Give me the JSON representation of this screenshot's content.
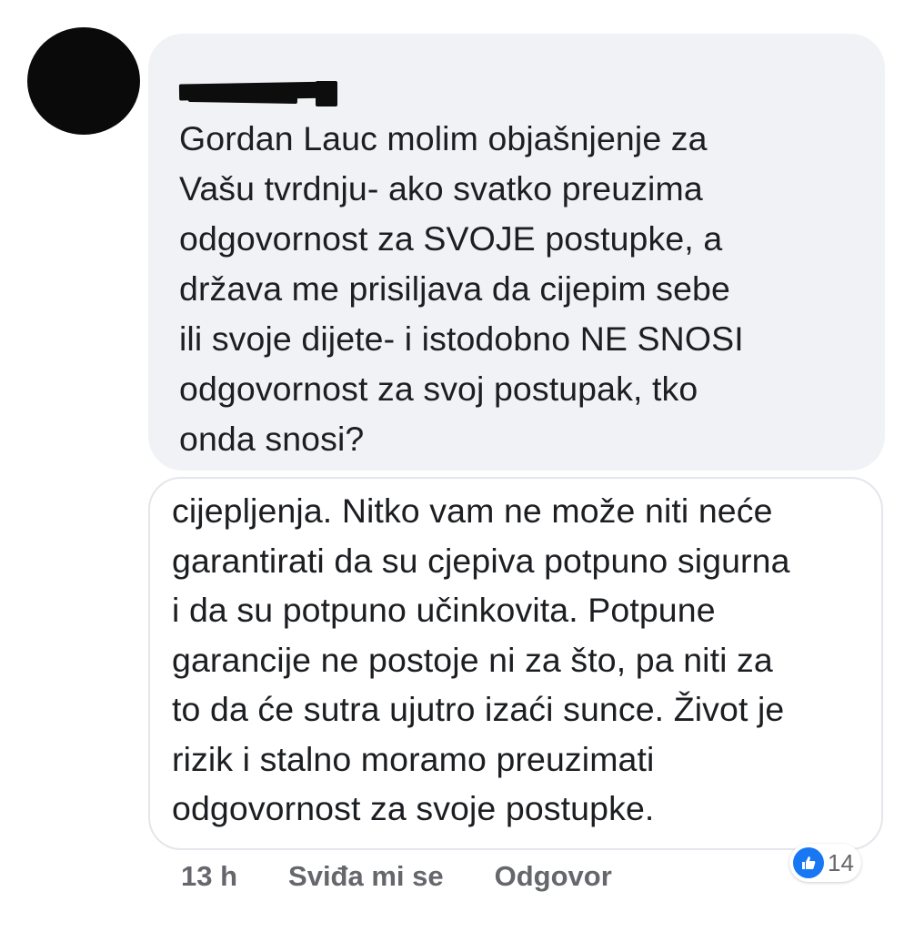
{
  "comment": {
    "text": "Gordan Lauc  molim objašnjenje za\nVašu tvrdnju- ako svatko preuzima\nodgovornost za SVOJE postupke, a\ndržava me prisiljava da cijepim sebe\nili svoje dijete- i istodobno NE SNOSI\nodgovornost za svoj postupak, tko\nonda snosi?"
  },
  "reply": {
    "text": "cijepljenja. Nitko vam ne može niti neće\ngarantirati da su cjepiva potpuno sigurna\ni da su potpuno učinkovita. Potpune\ngarancije ne postoje ni za što, pa niti za\nto da će sutra ujutro izaći sunce. Život je\nrizik i stalno moramo preuzimati\nodgovornost za svoje postupke."
  },
  "reactions": {
    "icon": "thumbs-up-icon",
    "count": "14",
    "color": "#1877f2"
  },
  "meta": {
    "time": "13 h",
    "like_label": "Sviđa mi se",
    "reply_label": "Odgovor"
  }
}
